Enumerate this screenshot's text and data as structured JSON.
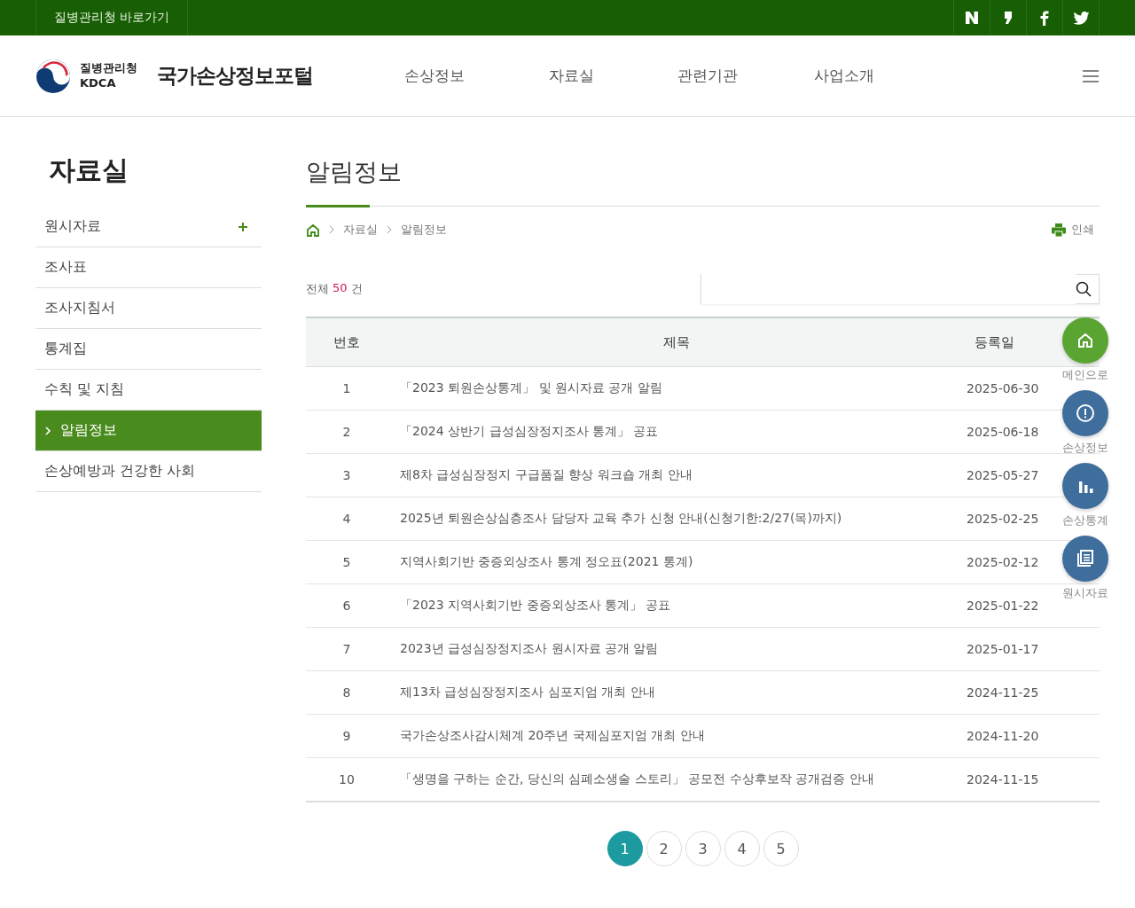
{
  "topbar": {
    "shortcut": "질병관리청 바로가기"
  },
  "header": {
    "agency": "질병관리청",
    "agency_abbr": "KDCA",
    "portal": "국가손상정보포털",
    "nav": [
      "손상정보",
      "자료실",
      "관련기관",
      "사업소개"
    ]
  },
  "sidebar": {
    "title": "자료실",
    "items": [
      {
        "label": "원시자료",
        "selected": false,
        "expandable": true
      },
      {
        "label": "조사표",
        "selected": false,
        "expandable": false
      },
      {
        "label": "조사지침서",
        "selected": false,
        "expandable": false
      },
      {
        "label": "통계집",
        "selected": false,
        "expandable": false
      },
      {
        "label": "수칙 및 지침",
        "selected": false,
        "expandable": false
      },
      {
        "label": "알림정보",
        "selected": true,
        "expandable": false
      },
      {
        "label": "손상예방과 건강한 사회",
        "selected": false,
        "expandable": false
      }
    ]
  },
  "page_title": "알림정보",
  "breadcrumb": [
    "자료실",
    "알림정보"
  ],
  "print": "인쇄",
  "total": {
    "before": "전체",
    "count": "50",
    "after": "건"
  },
  "table": {
    "columns": [
      "번호",
      "제목",
      "등록일"
    ],
    "rows": [
      {
        "no": "1",
        "title": "「2023 퇴원손상통계」 및 원시자료 공개 알림",
        "date": "2025-06-30"
      },
      {
        "no": "2",
        "title": "「2024 상반기 급성심장정지조사 통계」 공표",
        "date": "2025-06-18"
      },
      {
        "no": "3",
        "title": "제8차 급성심장정지 구급품질 향상 워크숍 개최 안내",
        "date": "2025-05-27"
      },
      {
        "no": "4",
        "title": "2025년 퇴원손상심층조사 담당자 교육 추가 신청 안내(신청기한:2/27(목)까지)",
        "date": "2025-02-25"
      },
      {
        "no": "5",
        "title": "지역사회기반 중증외상조사 통계 정오표(2021 통계)",
        "date": "2025-02-12"
      },
      {
        "no": "6",
        "title": "「2023 지역사회기반 중증외상조사 통계」 공표",
        "date": "2025-01-22"
      },
      {
        "no": "7",
        "title": "2023년 급성심장정지조사 원시자료 공개 알림",
        "date": "2025-01-17"
      },
      {
        "no": "8",
        "title": "제13차 급성심장정지조사 심포지엄 개최 안내",
        "date": "2024-11-25"
      },
      {
        "no": "9",
        "title": "국가손상조사감시체계 20주년 국제심포지엄 개최 안내",
        "date": "2024-11-20"
      },
      {
        "no": "10",
        "title": "「생명을 구하는 순간, 당신의 심폐소생술 스토리」 공모전 수상후보작 공개검증 안내",
        "date": "2024-11-15"
      }
    ]
  },
  "pagination": [
    {
      "label": "1",
      "selected": true
    },
    {
      "label": "2",
      "selected": false
    },
    {
      "label": "3",
      "selected": false
    },
    {
      "label": "4",
      "selected": false
    },
    {
      "label": "5",
      "selected": false
    }
  ],
  "quick_menu": [
    {
      "kind": "home",
      "label": "메인으로"
    },
    {
      "kind": "info",
      "label": "손상정보"
    },
    {
      "kind": "stats",
      "label": "손상통계"
    },
    {
      "kind": "data",
      "label": "원시자료"
    }
  ]
}
